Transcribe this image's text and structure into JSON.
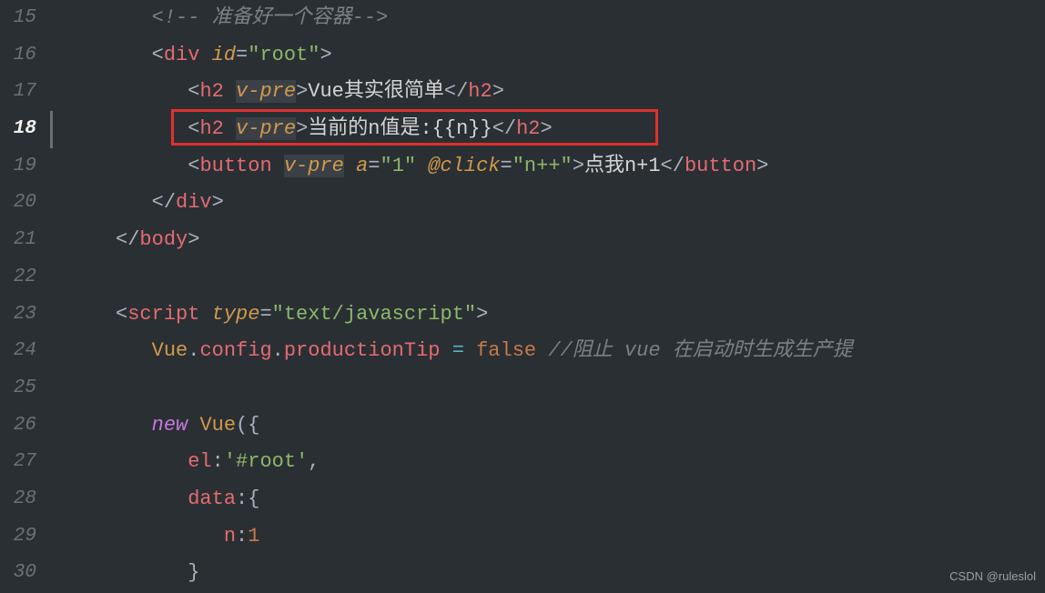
{
  "watermark": "CSDN @ruleslol",
  "gutter": [
    "15",
    "16",
    "17",
    "18",
    "19",
    "20",
    "21",
    "22",
    "23",
    "24",
    "25",
    "26",
    "27",
    "28",
    "29",
    "30"
  ],
  "current_line_index": 3,
  "code": {
    "l15": {
      "comment_open": "<!--",
      "comment_text": " 准备好一个容器",
      "comment_close": "-->"
    },
    "l16": {
      "lt": "<",
      "tag": "div",
      "attr": "id",
      "eq": "=",
      "q": "\"",
      "val": "root",
      "gt": ">"
    },
    "l17": {
      "lt": "<",
      "tag": "h2",
      "attr": "v-pre",
      "gt": ">",
      "text": "Vue其实很简单",
      "lt2": "</",
      "tag2": "h2",
      "gt2": ">"
    },
    "l18": {
      "lt": "<",
      "tag": "h2",
      "attr": "v-pre",
      "gt": ">",
      "text": "当前的n值是:{{n}}",
      "lt2": "</",
      "tag2": "h2",
      "gt2": ">"
    },
    "l19": {
      "lt": "<",
      "tag": "button",
      "attr1": "v-pre",
      "attr2": "a",
      "eq": "=",
      "q": "\"",
      "val2": "1",
      "attr3": "@click",
      "val3": "n++",
      "gt": ">",
      "text": "点我n+1",
      "lt2": "</",
      "tag2": "button",
      "gt2": ">"
    },
    "l20": {
      "lt": "</",
      "tag": "div",
      "gt": ">"
    },
    "l21": {
      "lt": "</",
      "tag": "body",
      "gt": ">"
    },
    "l23": {
      "lt": "<",
      "tag": "script",
      "attr": "type",
      "eq": "=",
      "q": "\"",
      "val": "text/javascript",
      "gt": ">"
    },
    "l24": {
      "obj": "Vue",
      "p": ".",
      "prop1": "config",
      "prop2": "productionTip",
      "eq": " = ",
      "val": "false",
      "comment": " //阻止 vue 在启动时生成生产提"
    },
    "l26": {
      "kw": "new",
      "cls": "Vue",
      "paren": "({"
    },
    "l27": {
      "key": "el",
      "colon": ":",
      "q": "'",
      "val": "#root",
      "comma": ","
    },
    "l28": {
      "key": "data",
      "colon": ":{"
    },
    "l29": {
      "key": "n",
      "colon": ":",
      "val": "1"
    },
    "l30": {
      "brace": "}"
    }
  }
}
